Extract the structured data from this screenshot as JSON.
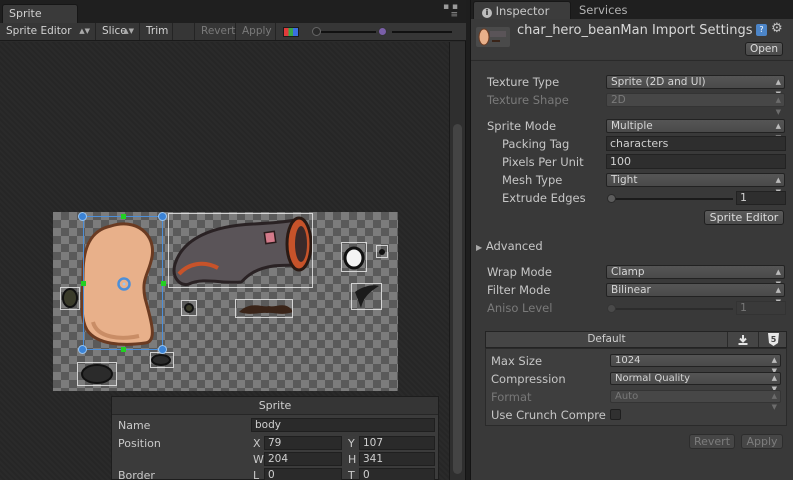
{
  "sprite_editor": {
    "tab_label": "Sprite Editor",
    "toolbar": {
      "mode_label": "Sprite Editor",
      "slice_label": "Slice",
      "trim_label": "Trim",
      "revert_label": "Revert",
      "apply_label": "Apply"
    },
    "sprite_box": {
      "title": "Sprite",
      "name_label": "Name",
      "name_value": "body",
      "position_label": "Position",
      "x_label": "X",
      "x_value": "79",
      "y_label": "Y",
      "y_value": "107",
      "w_label": "W",
      "w_value": "204",
      "h_label": "H",
      "h_value": "341",
      "border_label": "Border",
      "l_label": "L",
      "l_value": "0",
      "t_label": "T",
      "t_value": "0"
    }
  },
  "inspector": {
    "tabs": [
      {
        "label": "Inspector",
        "icon": "info-icon"
      },
      {
        "label": "Services"
      }
    ],
    "title": "char_hero_beanMan Import Settings",
    "open_label": "Open",
    "properties": {
      "texture_type_label": "Texture Type",
      "texture_type_value": "Sprite (2D and UI)",
      "texture_shape_label": "Texture Shape",
      "texture_shape_value": "2D",
      "sprite_mode_label": "Sprite Mode",
      "sprite_mode_value": "Multiple",
      "packing_tag_label": "Packing Tag",
      "packing_tag_value": "characters",
      "pixels_per_unit_label": "Pixels Per Unit",
      "pixels_per_unit_value": "100",
      "mesh_type_label": "Mesh Type",
      "mesh_type_value": "Tight",
      "extrude_edges_label": "Extrude Edges",
      "extrude_edges_value": "1",
      "sprite_editor_button": "Sprite Editor",
      "advanced_label": "Advanced",
      "wrap_mode_label": "Wrap Mode",
      "wrap_mode_value": "Clamp",
      "filter_mode_label": "Filter Mode",
      "filter_mode_value": "Bilinear",
      "aniso_level_label": "Aniso Level",
      "aniso_level_value": "1"
    },
    "platform": {
      "default_label": "Default",
      "max_size_label": "Max Size",
      "max_size_value": "1024",
      "compression_label": "Compression",
      "compression_value": "Normal Quality",
      "format_label": "Format",
      "format_value": "Auto",
      "use_crunch_label": "Use Crunch Compre"
    },
    "revert_label": "Revert",
    "apply_label": "Apply"
  }
}
